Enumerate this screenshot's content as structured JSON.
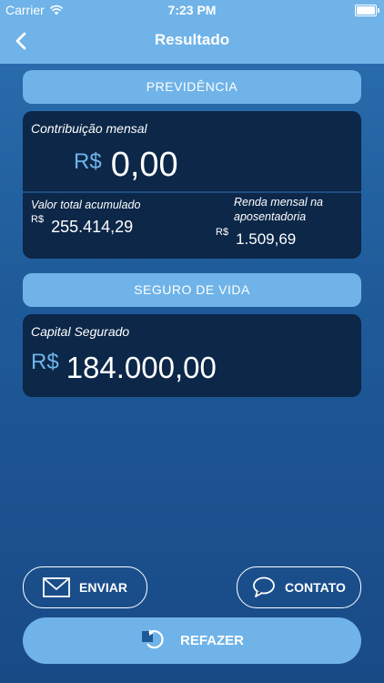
{
  "status_bar": {
    "carrier": "Carrier",
    "time": "7:23 PM"
  },
  "nav": {
    "title": "Resultado"
  },
  "previdencia": {
    "header": "PREVIDÊNCIA",
    "monthly_label": "Contribuição mensal",
    "monthly_currency": "R$",
    "monthly_value": "0,00",
    "total_label": "Valor total acumulado",
    "total_currency": "R$",
    "total_value": "255.414,29",
    "income_label": "Renda mensal na aposentadoria",
    "income_currency": "R$",
    "income_value": "1.509,69"
  },
  "seguro": {
    "header": "SEGURO DE VIDA",
    "capital_label": "Capital Segurado",
    "capital_currency": "R$",
    "capital_value": "184.000,00"
  },
  "actions": {
    "send_label": "ENVIAR",
    "contact_label": "CONTATO",
    "redo_label": "REFAZER"
  }
}
